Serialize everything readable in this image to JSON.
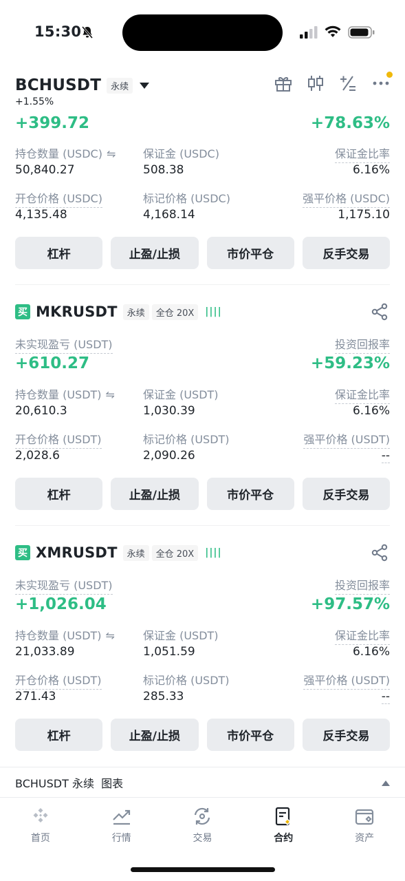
{
  "status": {
    "time": "15:30"
  },
  "colors": {
    "green": "#2ebd85",
    "accent": "#f0b90b",
    "text": "#1e2329",
    "muted": "#848e9c"
  },
  "positions": [
    {
      "symbol": "BCHUSDT",
      "tag": "永续",
      "change_pct": "+1.55%",
      "pnl": "+399.72",
      "roi": "+78.63%",
      "qty_label": "持仓数量 (USDC)",
      "qty": "50,840.27",
      "margin_label": "保证金 (USDC)",
      "margin": "508.38",
      "ratio_label": "保证金比率",
      "ratio": "6.16%",
      "entry_label": "开仓价格 (USDC)",
      "entry": "4,135.48",
      "mark_label": "标记价格 (USDC)",
      "mark": "4,168.14",
      "liq_label": "强平价格 (USDC)",
      "liq": "1,175.10"
    },
    {
      "symbol": "MKRUSDT",
      "badge": "买",
      "tag": "永续",
      "mode": "全仓 20X",
      "pnl_label": "未实现盈亏 (USDT)",
      "pnl": "+610.27",
      "roi_label": "投资回报率",
      "roi": "+59.23%",
      "qty_label": "持仓数量 (USDT)",
      "qty": "20,610.3",
      "margin_label": "保证金 (USDT)",
      "margin": "1,030.39",
      "ratio_label": "保证金比率",
      "ratio": "6.16%",
      "entry_label": "开仓价格 (USDT)",
      "entry": "2,028.6",
      "mark_label": "标记价格 (USDT)",
      "mark": "2,090.26",
      "liq_label": "强平价格 (USDT)",
      "liq": "--"
    },
    {
      "symbol": "XMRUSDT",
      "badge": "买",
      "tag": "永续",
      "mode": "全仓 20X",
      "pnl_label": "未实现盈亏 (USDT)",
      "pnl": "+1,026.04",
      "roi_label": "投资回报率",
      "roi": "+97.57%",
      "qty_label": "持仓数量 (USDT)",
      "qty": "21,033.89",
      "margin_label": "保证金 (USDT)",
      "margin": "1,051.59",
      "ratio_label": "保证金比率",
      "ratio": "6.16%",
      "entry_label": "开仓价格 (USDT)",
      "entry": "271.43",
      "mark_label": "标记价格 (USDT)",
      "mark": "285.33",
      "liq_label": "强平价格 (USDT)",
      "liq": "--"
    }
  ],
  "buttons": {
    "leverage": "杠杆",
    "tpsl": "止盈/止损",
    "market_close": "市价平仓",
    "reverse": "反手交易"
  },
  "chart_bar": {
    "label": "BCHUSDT 永续  图表"
  },
  "tabs": [
    {
      "label": "首页",
      "icon": "home-icon"
    },
    {
      "label": "行情",
      "icon": "markets-icon"
    },
    {
      "label": "交易",
      "icon": "trade-icon"
    },
    {
      "label": "合约",
      "icon": "futures-icon"
    },
    {
      "label": "资产",
      "icon": "wallet-icon"
    }
  ]
}
